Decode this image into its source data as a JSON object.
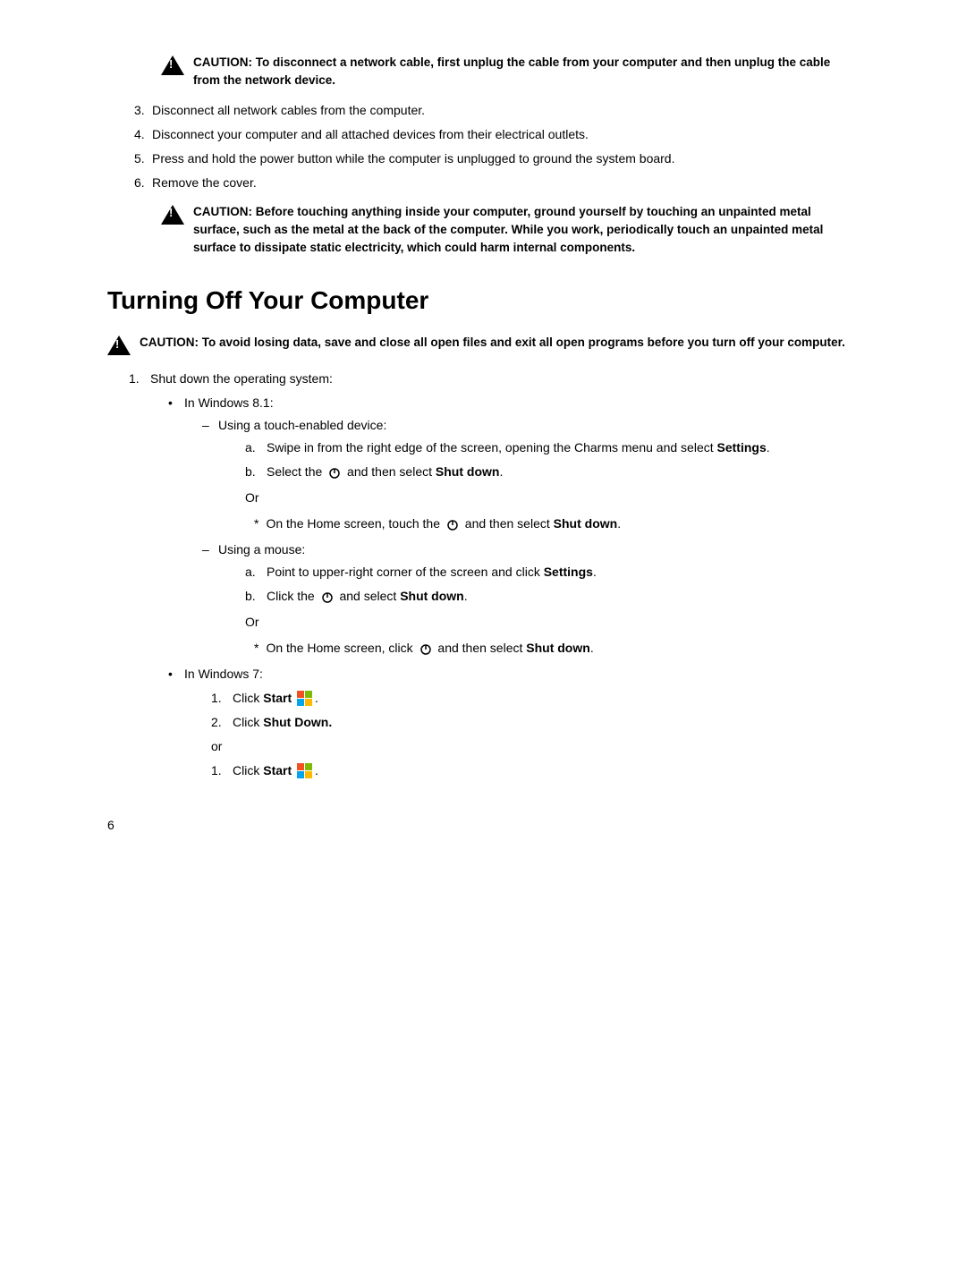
{
  "caution1": {
    "text": "CAUTION: To disconnect a network cable, first unplug the cable from your computer and then unplug the cable from the network device."
  },
  "steps_top": [
    {
      "num": "3",
      "text": "Disconnect all network cables from the computer."
    },
    {
      "num": "4",
      "text": "Disconnect your computer and all attached devices from their electrical outlets."
    },
    {
      "num": "5",
      "text": "Press and hold the power button while the computer is unplugged to ground the system board."
    },
    {
      "num": "6",
      "text": "Remove the cover."
    }
  ],
  "caution2": {
    "text": "CAUTION: Before touching anything inside your computer, ground yourself by touching an unpainted metal surface, such as the metal at the back of the computer. While you work, periodically touch an unpainted metal surface to dissipate static electricity, which could harm internal components."
  },
  "section_title": "Turning Off Your Computer",
  "caution3": {
    "text": "CAUTION: To avoid losing data, save and close all open files and exit all open programs before you turn off your computer."
  },
  "step1_label": "Shut down the operating system:",
  "windows81_label": "In Windows 8.1:",
  "touch_label": "Using a touch-enabled device:",
  "touch_a": "Swipe in from the right edge of the screen, opening the Charms menu and select",
  "touch_a_bold": "Settings",
  "touch_a_end": ".",
  "touch_b_prefix": "Select the",
  "touch_b_suffix": "and then select",
  "touch_b_bold": "Shut down",
  "touch_b_end": ".",
  "or1": "Or",
  "star1_prefix": "On the Home screen, touch the",
  "star1_suffix": "and then select",
  "star1_bold": "Shut down",
  "star1_end": ".",
  "mouse_label": "Using a mouse:",
  "mouse_a": "Point to upper-right corner of the screen and click",
  "mouse_a_bold": "Settings",
  "mouse_a_end": ".",
  "mouse_b_prefix": "Click the",
  "mouse_b_suffix": "and select",
  "mouse_b_bold": "Shut down",
  "mouse_b_end": ".",
  "or2": "Or",
  "star2_prefix": "On the Home screen, click",
  "star2_suffix": "and then select",
  "star2_bold": "Shut down",
  "star2_end": ".",
  "windows7_label": "In Windows 7:",
  "win7_1_prefix": "Click",
  "win7_1_bold": "Start",
  "win7_1_end": ".",
  "win7_2_prefix": "Click",
  "win7_2_bold": "Shut Down.",
  "or3": "or",
  "win7_alt1_prefix": "Click",
  "win7_alt1_bold": "Start",
  "win7_alt1_end": ".",
  "page_number": "6"
}
